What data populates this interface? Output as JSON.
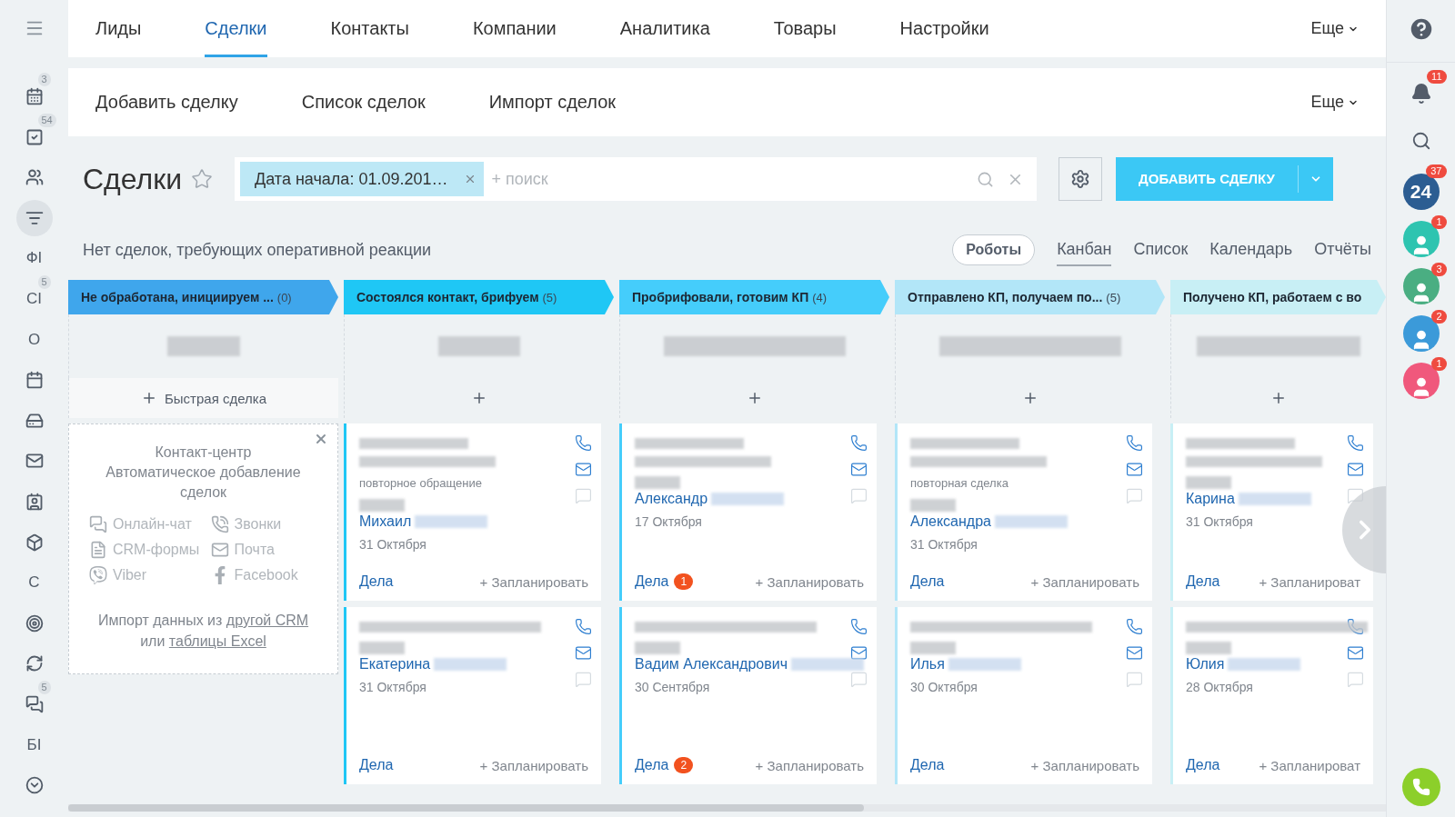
{
  "left_sidebar": {
    "items": [
      {
        "kind": "icon",
        "badge": "3",
        "selected": false
      },
      {
        "kind": "icon",
        "badge": "54",
        "selected": false
      },
      {
        "kind": "icon",
        "selected": false
      },
      {
        "kind": "icon",
        "selected": true
      },
      {
        "kind": "letters",
        "label": "ФІ",
        "selected": false
      },
      {
        "kind": "letters",
        "label": "СІ",
        "badge": "5",
        "selected": false
      },
      {
        "kind": "letters",
        "label": "О",
        "selected": false
      },
      {
        "kind": "icon",
        "selected": false
      },
      {
        "kind": "icon",
        "selected": false
      },
      {
        "kind": "icon",
        "selected": false
      },
      {
        "kind": "icon",
        "selected": false
      },
      {
        "kind": "icon",
        "selected": false
      },
      {
        "kind": "letters",
        "label": "С",
        "selected": false
      },
      {
        "kind": "icon",
        "selected": false
      },
      {
        "kind": "icon",
        "selected": false
      },
      {
        "kind": "icon",
        "badge": "5",
        "selected": false
      },
      {
        "kind": "letters",
        "label": "БІ",
        "selected": false
      },
      {
        "kind": "icon",
        "selected": false
      }
    ]
  },
  "top_nav": {
    "tabs": [
      {
        "label": "Лиды",
        "selected": false
      },
      {
        "label": "Сделки",
        "selected": true
      },
      {
        "label": "Контакты",
        "selected": false
      },
      {
        "label": "Компании",
        "selected": false
      },
      {
        "label": "Аналитика",
        "selected": false
      },
      {
        "label": "Товары",
        "selected": false
      },
      {
        "label": "Настройки",
        "selected": false
      }
    ],
    "more": "Еще"
  },
  "sub_nav": {
    "items": [
      "Добавить сделку",
      "Список сделок",
      "Импорт сделок"
    ],
    "more": "Еще"
  },
  "title": "Сделки",
  "filter": {
    "tag": "Дата начала: 01.09.201…",
    "placeholder": "+ поиск"
  },
  "add_button": "ДОБАВИТЬ СДЕЛКУ",
  "notice": "Нет сделок, требующих оперативной реакции",
  "robots_button": "Роботы",
  "view_tabs": [
    {
      "label": "Канбан",
      "selected": true
    },
    {
      "label": "Список",
      "selected": false
    },
    {
      "label": "Календарь",
      "selected": false
    },
    {
      "label": "Отчёты",
      "selected": false
    }
  ],
  "columns": [
    {
      "title": "Не обработана, инициируем ...",
      "count": "(0)",
      "color": "#3fa6ec",
      "add_label": "Быстрая сделка"
    },
    {
      "title": "Состоялся контакт, брифуем",
      "count": "(5)",
      "color": "#1fc7f5",
      "cards": [
        {
          "subtitle": "повторное обращение",
          "name": "Михаил",
          "date": "31 Октября",
          "tasks": "Дела",
          "plan": "+ Запланировать"
        },
        {
          "name": "Екатерина",
          "date": "31 Октября",
          "tasks": "Дела",
          "plan": "+ Запланировать"
        }
      ]
    },
    {
      "title": "Пробрифовали, готовим КП",
      "count": "(4)",
      "color": "#45cdfb",
      "cards": [
        {
          "name": "Александр",
          "date": "17 Октября",
          "tasks": "Дела",
          "tasks_count": "1",
          "plan": "+ Запланировать"
        },
        {
          "name": "Вадим Александрович",
          "date": "30 Сентября",
          "tasks": "Дела",
          "tasks_count": "2",
          "plan": "+ Запланировать"
        }
      ]
    },
    {
      "title": "Отправлено КП, получаем по...",
      "count": "(5)",
      "color": "#b2e6f8",
      "cards": [
        {
          "subtitle": "повторная сделка",
          "name": "Александра",
          "date": "31 Октября",
          "tasks": "Дела",
          "plan": "+ Запланировать"
        },
        {
          "name": "Илья",
          "date": "30 Октября",
          "tasks": "Дела",
          "plan": "+ Запланировать"
        }
      ]
    },
    {
      "title": "Получено КП, работаем с во",
      "color": "#c8eff5",
      "cards": [
        {
          "name": "Карина",
          "date": "31 Октября",
          "tasks": "Дела",
          "plan": "+ Запланироват"
        },
        {
          "name": "Юлия",
          "date": "28 Октября",
          "tasks": "Дела",
          "plan": "+ Запланироват"
        }
      ]
    }
  ],
  "contact_center": {
    "title": "Контакт-центр",
    "subtitle": "Автоматическое добавление сделок",
    "channels": [
      "Онлайн-чат",
      "Звонки",
      "CRM-формы",
      "Почта",
      "Viber",
      "Facebook"
    ],
    "import": {
      "before": "Импорт данных из",
      "link1": "другой CRM",
      "middle": "или",
      "link2": "таблицы Excel"
    }
  },
  "right_sidebar": {
    "notifications_badge": "11",
    "app_logo": "24",
    "app_badge": "37",
    "contacts": [
      {
        "color": "#2ec4b0",
        "badge": "1"
      },
      {
        "color": "#4aae82",
        "badge": "3"
      },
      {
        "color": "#3b9ad9",
        "badge": "2"
      },
      {
        "color": "#f0587c",
        "badge": "1"
      }
    ]
  }
}
